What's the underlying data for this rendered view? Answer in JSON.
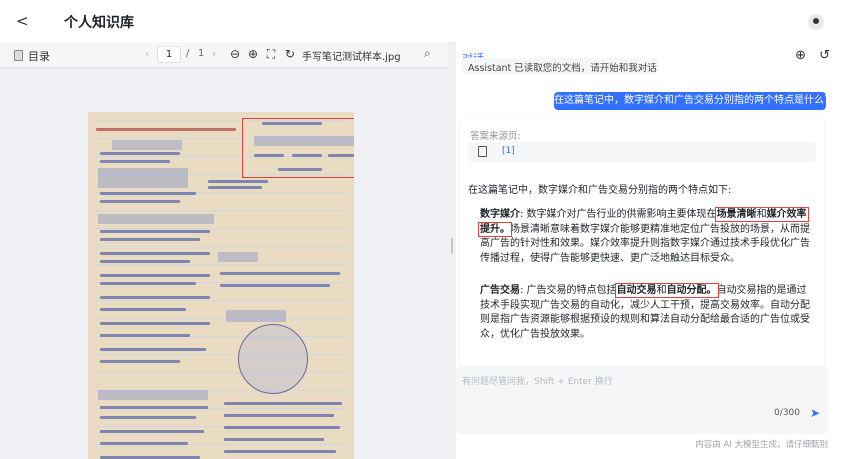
{
  "header": {
    "back_glyph": "<",
    "title": "个人知识库"
  },
  "viewer": {
    "toc_label": "目录",
    "page_current": "1",
    "page_sep": "/",
    "page_total": "1",
    "file_name": "手写笔记测试样本.jpg"
  },
  "chat": {
    "panel_title": "对话",
    "previous_message": "Assistant 已读取您的文档，请开始和我对话...",
    "user_question": "在这篇笔记中，数字媒介和广告交易分别指的两个特点是什么？",
    "answer": {
      "source_label": "答案来源页:",
      "source_ref": "[1]",
      "intro": "在这篇笔记中，数字媒介和广告交易分别指的两个特点如下:",
      "p1_term": "数字媒介",
      "p1_a": ": 数字媒介对广告行业的供需影响主要体现在",
      "p1_k1": "场景清晰",
      "p1_and": "和",
      "p1_k2": "媒介效率提升。",
      "p1_rest": "场景清晰意味着数字媒介能够更精准地定位广告投放的场景，从而提高广告的针对性和效果。媒介效率提升则指数字媒介通过技术手段优化广告传播过程，使得广告能够更快速、更广泛地触达目标受众。",
      "p2_term": "广告交易",
      "p2_a": ": 广告交易的特点包括",
      "p2_k1": "自动交易",
      "p2_and": "和",
      "p2_k2": "自动分配。",
      "p2_rest": "自动交易指的是通过技术手段实现广告交易的自动化，减少人工干预，提高交易效率。自动分配则是指广告资源能够根据预设的规则和算法自动分配给最合适的广告位或受众，优化广告投放效果。"
    },
    "input_placeholder": "有问题尽管问我，Shift + Enter 换行",
    "counter": "0/300",
    "disclaimer": "内容由 AI 大模型生成，请仔细甄别"
  },
  "colors": {
    "accent": "#3370ff",
    "highlight_box": "#e04242"
  },
  "icons": [
    "back-icon",
    "avatar-icon",
    "toc-icon",
    "zoom-out-icon",
    "zoom-in-icon",
    "fit-icon",
    "rotate-icon",
    "search-icon",
    "new-chat-icon",
    "history-icon",
    "source-doc-icon",
    "send-icon"
  ]
}
